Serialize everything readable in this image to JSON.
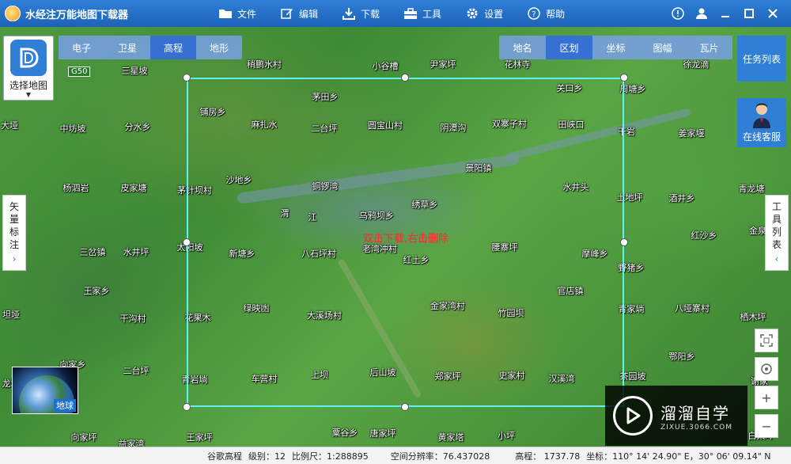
{
  "app": {
    "title": "水经注万能地图下载器"
  },
  "menu": [
    {
      "label": "文件",
      "icon": "folder-icon"
    },
    {
      "label": "编辑",
      "icon": "edit-icon"
    },
    {
      "label": "下载",
      "icon": "download-icon"
    },
    {
      "label": "工具",
      "icon": "toolbox-icon"
    },
    {
      "label": "设置",
      "icon": "gear-icon"
    },
    {
      "label": "帮助",
      "icon": "help-icon"
    }
  ],
  "map_type_tabs": [
    {
      "label": "电子",
      "active": false
    },
    {
      "label": "卫星",
      "active": false
    },
    {
      "label": "高程",
      "active": true
    },
    {
      "label": "地形",
      "active": false
    }
  ],
  "overlay_tabs": [
    {
      "label": "地名",
      "active": false
    },
    {
      "label": "区划",
      "active": true
    },
    {
      "label": "坐标",
      "active": false
    },
    {
      "label": "图幅",
      "active": false
    },
    {
      "label": "瓦片",
      "active": false
    }
  ],
  "select_map": {
    "label": "选择地图"
  },
  "task_list": {
    "label": "任务列表"
  },
  "online_service": {
    "label": "在线客服"
  },
  "left_panel": {
    "label_lines": [
      "矢",
      "量",
      "标",
      "注"
    ]
  },
  "right_panel": {
    "label_lines": [
      "工",
      "具",
      "列",
      "表"
    ]
  },
  "selection": {
    "hint": "双击下载,右击删除"
  },
  "earth": {
    "label": "地球"
  },
  "watermark": {
    "main": "溜溜自学",
    "sub": "ZIXUE.3066.COM"
  },
  "road_badge": "G50",
  "places": [
    {
      "name": "稍鹏水村"
    },
    {
      "name": "小谷槽"
    },
    {
      "name": "尹家坪"
    },
    {
      "name": "花林寺"
    },
    {
      "name": "徐龙滴"
    },
    {
      "name": "三星坡"
    },
    {
      "name": "茅田乡"
    },
    {
      "name": "关口乡"
    },
    {
      "name": "周塘乡"
    },
    {
      "name": "大垭"
    },
    {
      "name": "铺房乡"
    },
    {
      "name": "麻扎水"
    },
    {
      "name": "二台坪"
    },
    {
      "name": "圆宝山村"
    },
    {
      "name": "阴潭沟"
    },
    {
      "name": "双寨子村"
    },
    {
      "name": "田峡口"
    },
    {
      "name": "干岩"
    },
    {
      "name": "姜家堰"
    },
    {
      "name": "中坊坡"
    },
    {
      "name": "分水乡"
    },
    {
      "name": "景阳镇"
    },
    {
      "name": "杨泗岩"
    },
    {
      "name": "皮家塘"
    },
    {
      "name": "茅针坝村"
    },
    {
      "name": "沙地乡"
    },
    {
      "name": "铜锣湾"
    },
    {
      "name": "水井头"
    },
    {
      "name": "土地坪"
    },
    {
      "name": "酒井乡"
    },
    {
      "name": "青龙塘"
    },
    {
      "name": "渭"
    },
    {
      "name": "江"
    },
    {
      "name": "乌鸦坝乡"
    },
    {
      "name": "绣草乡"
    },
    {
      "name": "红沙乡"
    },
    {
      "name": "金泉"
    },
    {
      "name": "三岔镇"
    },
    {
      "name": "水井坪"
    },
    {
      "name": "太阳坡"
    },
    {
      "name": "新塘乡"
    },
    {
      "name": "八石坪村"
    },
    {
      "name": "老湾冲村"
    },
    {
      "name": "腰寨坪"
    },
    {
      "name": "摩峰乡"
    },
    {
      "name": "红土乡"
    },
    {
      "name": "野猪乡"
    },
    {
      "name": "王家乡"
    },
    {
      "name": "官店镇"
    },
    {
      "name": "坦垭"
    },
    {
      "name": "干沟村"
    },
    {
      "name": "绿映凼"
    },
    {
      "name": "花果木"
    },
    {
      "name": "大溪场村"
    },
    {
      "name": "金家湾村"
    },
    {
      "name": "竹园坝"
    },
    {
      "name": "青家埫"
    },
    {
      "name": "八垭寨村"
    },
    {
      "name": "栖木坪"
    },
    {
      "name": "向家乡"
    },
    {
      "name": "二台坪"
    },
    {
      "name": "鄂阳乡"
    },
    {
      "name": "龙坪村"
    },
    {
      "name": "青岩埫"
    },
    {
      "name": "车营村"
    },
    {
      "name": "上坝"
    },
    {
      "name": "后山坡"
    },
    {
      "name": "郑家坪"
    },
    {
      "name": "史家村"
    },
    {
      "name": "汉溪湾"
    },
    {
      "name": "茶园坡"
    },
    {
      "name": "谢家"
    },
    {
      "name": "向家坪"
    },
    {
      "name": "王家坪"
    },
    {
      "name": "粟谷乡"
    },
    {
      "name": "唐家坪"
    },
    {
      "name": "黄家塔"
    },
    {
      "name": "小坪"
    },
    {
      "name": "白果坪"
    },
    {
      "name": "益家湾"
    }
  ],
  "status": {
    "map_name": "谷歌高程",
    "level": "级别：12",
    "scale": "比例尺：1:288895",
    "resolution": "空间分辨率：76.437028",
    "elevation": "高程：  1737.78",
    "coords": "坐标：110° 14' 24.90\" E，30° 06' 09.14\" N"
  }
}
